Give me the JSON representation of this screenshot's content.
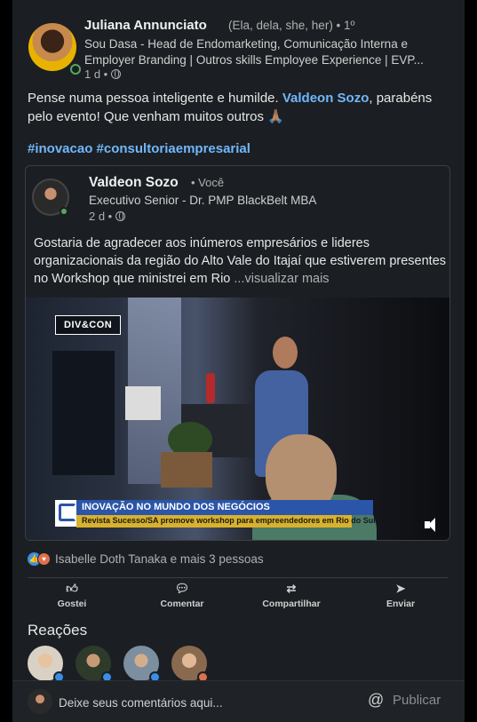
{
  "post": {
    "author_name": "Juliana Annunciato",
    "author_pronouns": "(Ela, dela, she, her) • 1º",
    "author_headline": "Sou Dasa - Head de Endomarketing, Comunicação Interna e Employer Branding | Outros skills Employee Experience | EVP...",
    "time": "1 d •",
    "text_before": "Pense numa pessoa inteligente e humilde. ",
    "mention": "Valdeon Sozo",
    "text_after": ", parabéns pelo evento! Que venham muitos outros 🙏🏽",
    "hashtags": "#inovacao #consultoriaempresarial"
  },
  "shared": {
    "author_name": "Valdeon Sozo",
    "you_label": "• Você",
    "headline": "Executivo Senior - Dr. PMP BlackBelt MBA",
    "time": "2 d •",
    "text": "Gostaria de agradecer aos inúmeros empresários e lideres organizacionais da região do Alto Vale do Itajaí que estiverem presentes no Workshop que ministrei em Rio ",
    "see_more": "...visualizar mais",
    "video": {
      "logo": "DIV&CON",
      "news_title": "INOVAÇÃO NO MUNDO DOS NEGÓCIOS",
      "news_sub": "Revista Sucesso/SA promove workshop para empreendedores em Rio do Sul"
    }
  },
  "social": {
    "reactions_text": "Isabelle Doth Tanaka e mais 3 pessoas"
  },
  "actions": [
    {
      "label": "Gostei",
      "icon": "thumb-up-icon"
    },
    {
      "label": "Comentar",
      "icon": "comment-icon"
    },
    {
      "label": "Compartilhar",
      "icon": "repost-icon"
    },
    {
      "label": "Enviar",
      "icon": "send-icon"
    }
  ],
  "reactions_title": "Reações",
  "comment": {
    "placeholder": "Deixe seus comentários aqui...",
    "publish": "Publicar"
  }
}
